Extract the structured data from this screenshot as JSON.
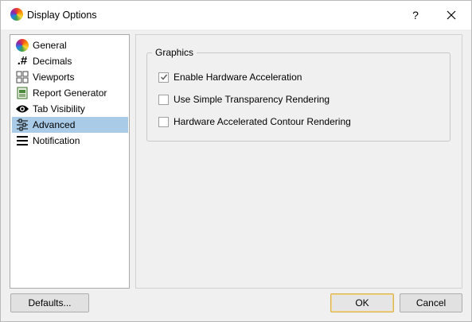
{
  "window": {
    "title": "Display Options",
    "help_label": "?",
    "icon": "color-wheel-icon"
  },
  "nav": {
    "items": [
      {
        "label": "General",
        "icon": "color-wheel-icon"
      },
      {
        "label": "Decimals",
        "icon": "decimal-hash-icon"
      },
      {
        "label": "Viewports",
        "icon": "viewports-grid-icon"
      },
      {
        "label": "Report Generator",
        "icon": "report-icon"
      },
      {
        "label": "Tab Visibility",
        "icon": "eye-icon"
      },
      {
        "label": "Advanced",
        "icon": "sliders-icon",
        "selected": true
      },
      {
        "label": "Notification",
        "icon": "menu-lines-icon"
      }
    ]
  },
  "graphics": {
    "group_title": "Graphics",
    "options": [
      {
        "label": "Enable Hardware Acceleration",
        "checked": true
      },
      {
        "label": "Use Simple Transparency Rendering",
        "checked": false
      },
      {
        "label": "Hardware Accelerated Contour Rendering",
        "checked": false
      }
    ]
  },
  "buttons": {
    "defaults": "Defaults...",
    "ok": "OK",
    "cancel": "Cancel"
  },
  "colors": {
    "selection": "#a9cbe8",
    "default_button_border": "#d9b14f"
  }
}
